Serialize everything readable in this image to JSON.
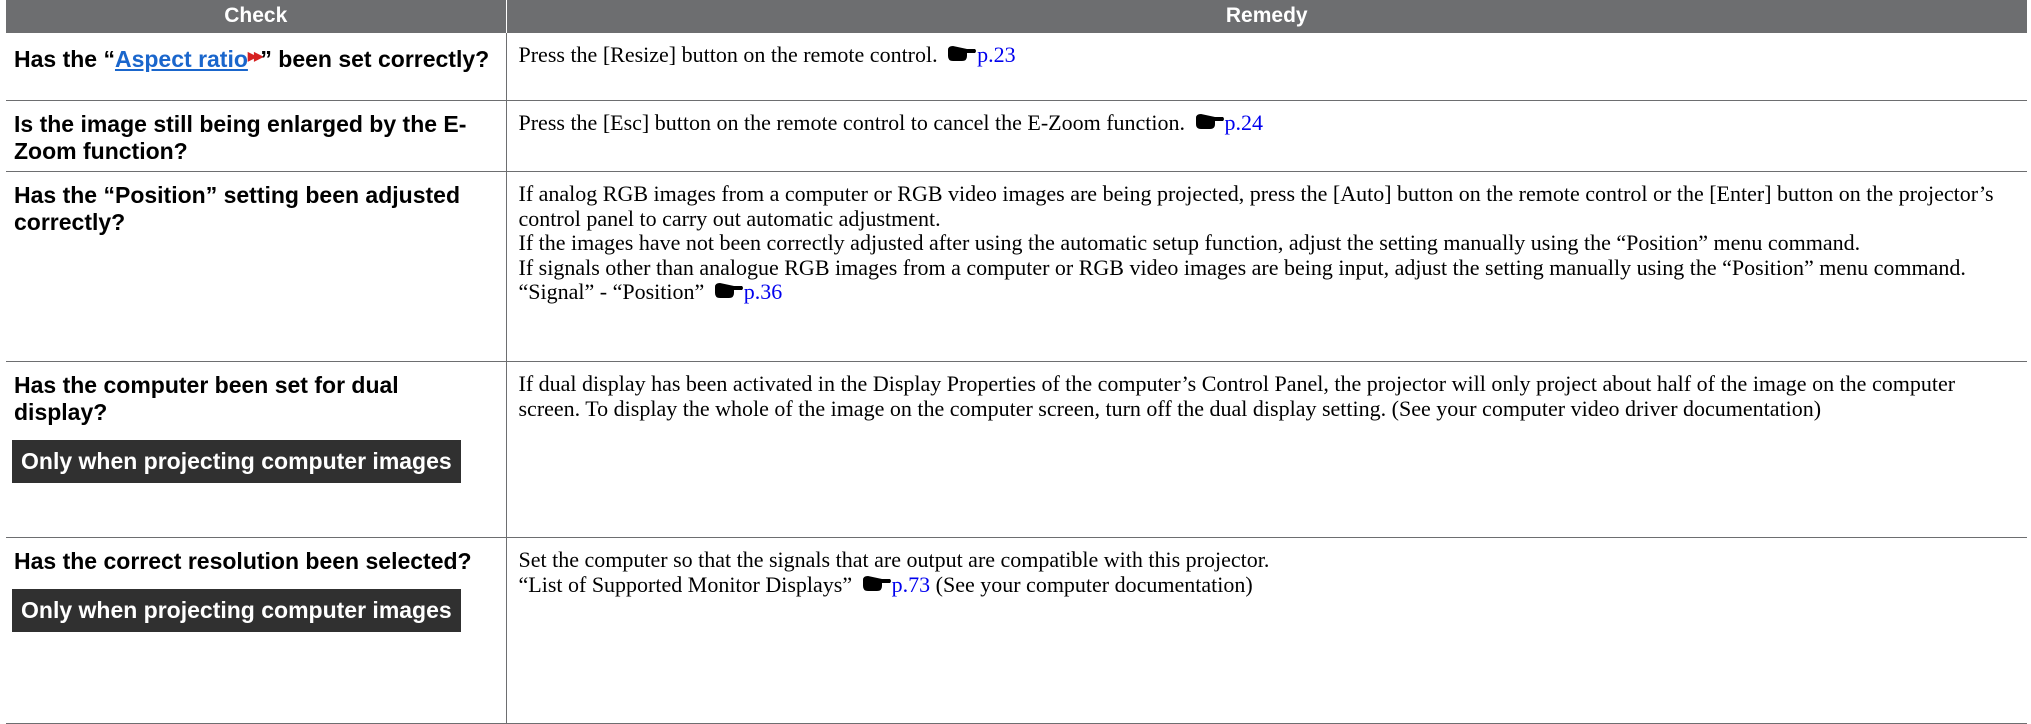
{
  "header": {
    "check": "Check",
    "remedy": "Remedy"
  },
  "rows": [
    {
      "check_pre": "Has the “",
      "check_link": "Aspect ratio",
      "check_post": "” been set correctly?",
      "remedy": "Press the [Resize] button on the remote control.",
      "ref": "p.23"
    },
    {
      "check": "Is the image still being enlarged by the E-Zoom function?",
      "remedy": "Press the [Esc] button on the remote control to cancel the E-Zoom function.",
      "ref": "p.24"
    },
    {
      "check": "Has the “Position” setting been adjusted correctly?",
      "remedy_p1": "If analog RGB images from a computer or RGB video images are being projected, press the [Auto] button on the remote control or the [Enter] button on the projector’s control panel to carry out automatic adjustment.",
      "remedy_p2": "If the images have not been correctly adjusted after using the automatic setup function, adjust the setting manually using the “Position” menu command.",
      "remedy_p3": "If signals other than analogue RGB images from a computer or RGB video images are being input, adjust the setting manually using the “Position” menu command. “Signal” - “Position”",
      "ref": "p.36"
    },
    {
      "check": "Has the computer been set for dual display?",
      "badge": "Only when projecting computer images",
      "remedy": "If dual display has been activated in the Display Properties of the computer’s Control Panel, the projector will only project about half of the image on the computer screen. To display the whole of the image on the computer screen, turn off the dual display setting. (See your computer video driver documentation)"
    },
    {
      "check": "Has the correct resolution been selected?",
      "badge": "Only when projecting computer images",
      "remedy_l1": "Set the computer so that the signals that are output are compatible with this projector.",
      "remedy_l2_pre": "“List of Supported Monitor Displays”",
      "ref": "p.73",
      "remedy_l2_post": "(See your computer documentation)"
    }
  ]
}
